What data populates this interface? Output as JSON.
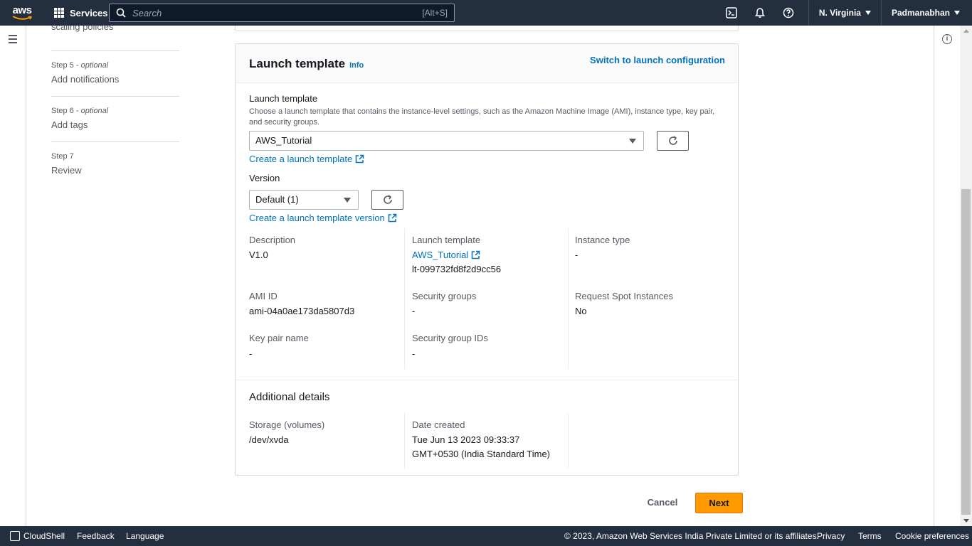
{
  "topnav": {
    "logo": "aws",
    "services_label": "Services",
    "search_placeholder": "Search",
    "search_shortcut": "[Alt+S]",
    "region": "N. Virginia",
    "user": "Padmanabhan",
    "icons": [
      "cloudshell-icon",
      "bell-icon",
      "help-icon"
    ]
  },
  "steps": {
    "cut_off_title": "scaling policies",
    "items": [
      {
        "label": "Step 5",
        "optional": "optional",
        "title": "Add notifications"
      },
      {
        "label": "Step 6",
        "optional": "optional",
        "title": "Add tags"
      },
      {
        "label": "Step 7",
        "optional": "",
        "title": "Review"
      }
    ],
    "separator": " - "
  },
  "panel": {
    "title": "Launch template",
    "info": "Info",
    "switch_link": "Switch to launch configuration",
    "lt_field": {
      "label": "Launch template",
      "description": "Choose a launch template that contains the instance-level settings, such as the Amazon Machine Image (AMI), instance type, key pair, and security groups.",
      "selected": "AWS_Tutorial",
      "create_link": "Create a launch template"
    },
    "version_field": {
      "label": "Version",
      "selected": "Default (1)",
      "create_link": "Create a launch template version"
    },
    "details": {
      "description_label": "Description",
      "description_value": "V1.0",
      "lt_label": "Launch template",
      "lt_link": "AWS_Tutorial",
      "lt_id": "lt-099732fd8f2d9cc56",
      "instance_type_label": "Instance type",
      "instance_type_value": "-",
      "ami_label": "AMI ID",
      "ami_value": "ami-04a0ae173da5807d3",
      "sg_label": "Security groups",
      "sg_value": "-",
      "spot_label": "Request Spot Instances",
      "spot_value": "No",
      "keypair_label": "Key pair name",
      "keypair_value": "-",
      "sgid_label": "Security group IDs",
      "sgid_value": "-"
    },
    "additional": {
      "title": "Additional details",
      "storage_label": "Storage (volumes)",
      "storage_value": "/dev/xvda",
      "date_label": "Date created",
      "date_value_line1": "Tue Jun 13 2023 09:33:37",
      "date_value_line2": "GMT+0530 (India Standard Time)"
    }
  },
  "actions": {
    "cancel": "Cancel",
    "next": "Next"
  },
  "footer": {
    "cloudshell": "CloudShell",
    "feedback": "Feedback",
    "language": "Language",
    "copyright": "© 2023, Amazon Web Services India Private Limited or its affiliates.",
    "privacy": "Privacy",
    "terms": "Terms",
    "cookies": "Cookie preferences"
  },
  "colors": {
    "nav_bg": "#232f3e",
    "link": "#0073bb",
    "primary_button": "#ff9900"
  }
}
